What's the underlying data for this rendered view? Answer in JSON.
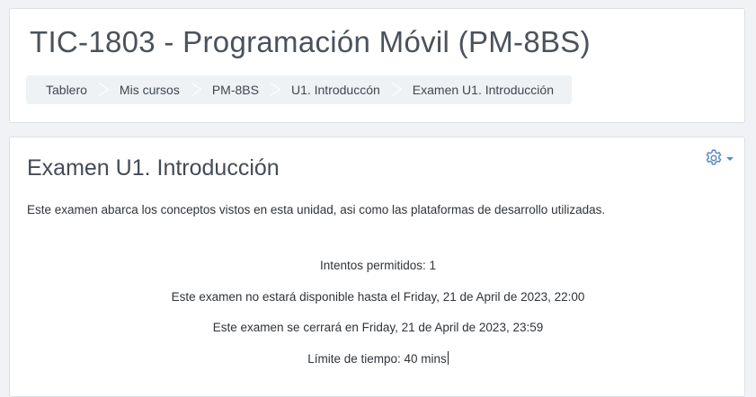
{
  "header": {
    "course_title": "TIC-1803 - Programación Móvil (PM-8BS)",
    "breadcrumb": [
      {
        "label": "Tablero"
      },
      {
        "label": "Mis cursos"
      },
      {
        "label": "PM-8BS"
      },
      {
        "label": "U1. Introduccón"
      },
      {
        "label": "Examen U1. Introducción"
      }
    ]
  },
  "main": {
    "quiz_title": "Examen U1. Introducción",
    "settings_icon": "gear-icon",
    "description": "Este examen abarca los conceptos vistos en esta unidad, asi como las plataformas de desarrollo utilizadas.",
    "info": {
      "attempts": "Intentos permitidos: 1",
      "open_date": "Este examen no estará disponible hasta el Friday, 21 de April de 2023, 22:00",
      "close_date": "Este examen se cerrará en Friday, 21 de April de 2023, 23:59",
      "time_limit": "Límite de tiempo: 40 mins"
    }
  },
  "colors": {
    "page_bg": "#f1f2f5",
    "card_bg": "#ffffff",
    "breadcrumb_bg": "#eef2f5",
    "accent": "#5b8bbf"
  }
}
